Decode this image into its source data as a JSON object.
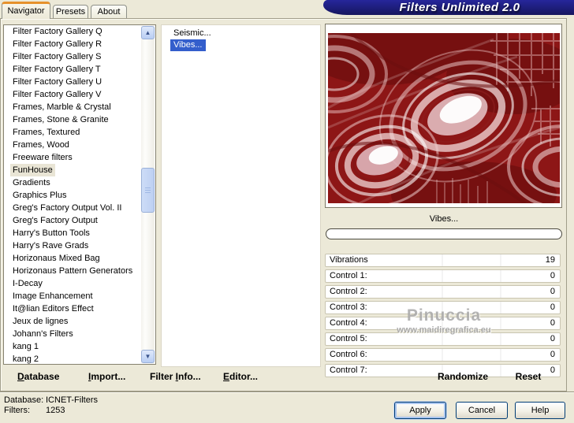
{
  "window": {
    "title": "Filters Unlimited 2.0"
  },
  "tabs": [
    {
      "label": "Navigator",
      "active": true
    },
    {
      "label": "Presets"
    },
    {
      "label": "About"
    }
  ],
  "category_list": {
    "items": [
      {
        "label": "Filter Factory Gallery Q"
      },
      {
        "label": "Filter Factory Gallery R"
      },
      {
        "label": "Filter Factory Gallery S"
      },
      {
        "label": "Filter Factory Gallery T"
      },
      {
        "label": "Filter Factory Gallery U"
      },
      {
        "label": "Filter Factory Gallery V"
      },
      {
        "label": "Frames, Marble & Crystal"
      },
      {
        "label": "Frames, Stone & Granite"
      },
      {
        "label": "Frames, Textured"
      },
      {
        "label": "Frames, Wood"
      },
      {
        "label": "Freeware filters"
      },
      {
        "label": "FunHouse",
        "selected": true
      },
      {
        "label": "Gradients"
      },
      {
        "label": "Graphics Plus"
      },
      {
        "label": "Greg's Factory Output Vol. II"
      },
      {
        "label": "Greg's Factory Output"
      },
      {
        "label": "Harry's Button Tools"
      },
      {
        "label": "Harry's Rave Grads"
      },
      {
        "label": "Horizonaus Mixed Bag"
      },
      {
        "label": "Horizonaus Pattern Generators"
      },
      {
        "label": "I-Decay"
      },
      {
        "label": "Image Enhancement"
      },
      {
        "label": "It@lian Editors Effect"
      },
      {
        "label": "Jeux de lignes"
      },
      {
        "label": "Johann's Filters"
      },
      {
        "label": "kang 1"
      },
      {
        "label": "kang 2"
      }
    ]
  },
  "filter_list": {
    "items": [
      {
        "label": "Seismic..."
      },
      {
        "label": "Vibes...",
        "selected": true
      }
    ]
  },
  "preview": {
    "caption": "Vibes..."
  },
  "controls": {
    "rows": [
      {
        "label": "Vibrations",
        "value": "19"
      },
      {
        "label": "Control 1:",
        "value": "0"
      },
      {
        "label": "Control 2:",
        "value": "0"
      },
      {
        "label": "Control 3:",
        "value": "0"
      },
      {
        "label": "Control 4:",
        "value": "0"
      },
      {
        "label": "Control 5:",
        "value": "0"
      },
      {
        "label": "Control 6:",
        "value": "0"
      },
      {
        "label": "Control 7:",
        "value": "0"
      }
    ],
    "randomize_label": "Randomize",
    "reset_label": "Reset"
  },
  "commands": {
    "database": {
      "pre": "",
      "accel": "D",
      "post": "atabase"
    },
    "import": {
      "pre": "",
      "accel": "I",
      "post": "mport..."
    },
    "filter_info": {
      "pre": "Filter ",
      "accel": "I",
      "post": "nfo..."
    },
    "editor": {
      "pre": "",
      "accel": "E",
      "post": "ditor..."
    }
  },
  "status": {
    "database_label": "Database:",
    "database_value": "ICNET-Filters",
    "filters_label": "Filters:",
    "filters_value": "1253"
  },
  "buttons": {
    "apply": "Apply",
    "cancel": "Cancel",
    "help": "Help"
  },
  "watermark": {
    "name": "Pinuccia",
    "url": "www.maidiregrafica.eu"
  },
  "colors": {
    "dialog_bg": "#ece9d8",
    "banner_blue": "#1c1c7d",
    "tab_accent_orange": "#e6912c",
    "selection_blue": "#335ecc",
    "inactive_selection": "#e9e5d5",
    "preview_red": "#8d1616"
  }
}
